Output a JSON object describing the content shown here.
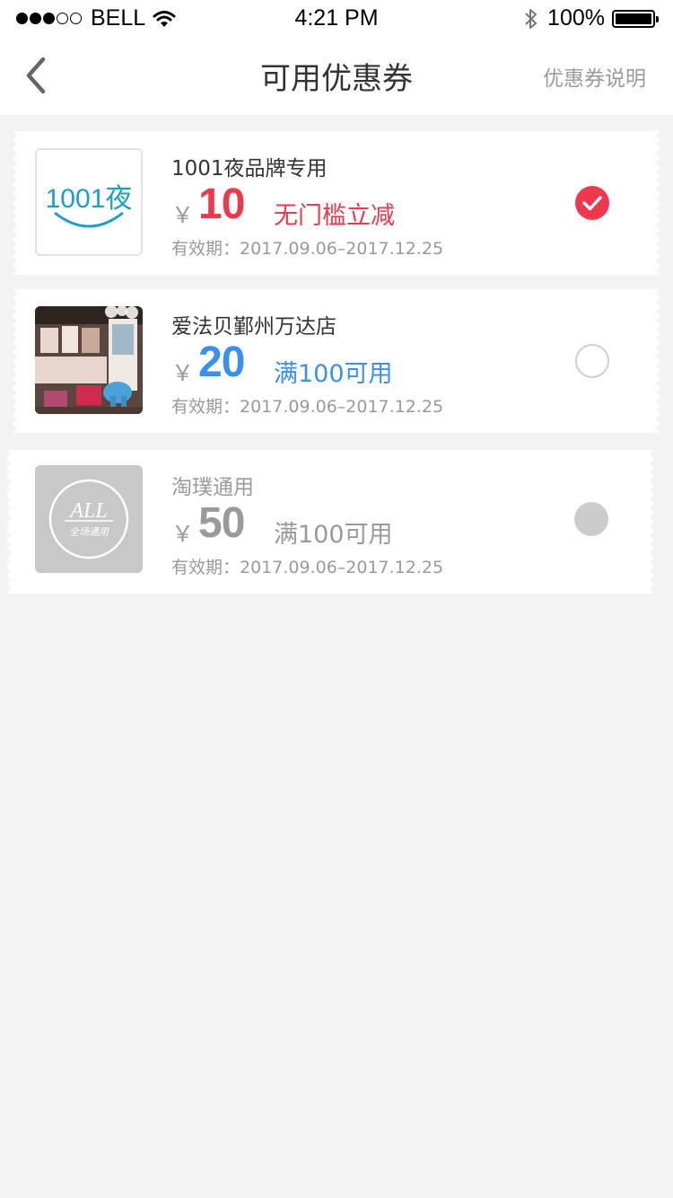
{
  "status_bar": {
    "carrier": "BELL",
    "time": "4:21 PM",
    "battery": "100%",
    "signal_bars_filled": 3,
    "signal_bars_total": 5
  },
  "nav": {
    "title": "可用优惠券",
    "action": "优惠券说明",
    "back_icon": "chevron-left-icon"
  },
  "colors": {
    "red": "#f0374e",
    "blue": "#3b8ff0",
    "gray": "#9a9a9a"
  },
  "coupons": [
    {
      "logo": "1001夜",
      "title": "1001夜品牌专用",
      "currency": "￥",
      "amount": "10",
      "rule": "无门槛立减",
      "validity": "有效期：2017.09.06–2017.12.25",
      "state": "selected",
      "accent": "#f0374e"
    },
    {
      "title": "爱法贝鄞州万达店",
      "currency": "￥",
      "amount": "20",
      "rule": "满100可用",
      "validity": "有效期：2017.09.06–2017.12.25",
      "state": "unselected",
      "accent": "#3b8ff0"
    },
    {
      "logo_text": "ALL",
      "logo_sub": "全场通用",
      "title": "淘璞通用",
      "currency": "￥",
      "amount": "50",
      "rule": "满100可用",
      "validity": "有效期：2017.09.06–2017.12.25",
      "state": "disabled",
      "accent": "#9a9a9a"
    }
  ]
}
